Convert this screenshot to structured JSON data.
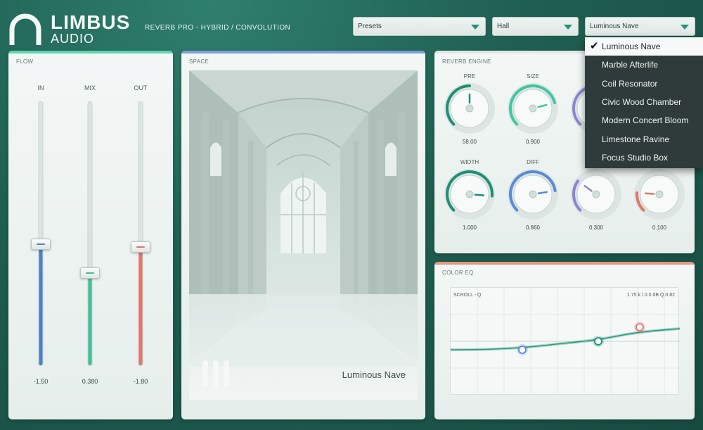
{
  "brand": {
    "name_top": "LIMBUS",
    "name_bottom": "AUDIO",
    "subtitle": "REVERB PRO  -  HYBRID / CONVOLUTION"
  },
  "dropdowns": {
    "presets": "Presets",
    "category": "Hall",
    "space": "Luminous Nave"
  },
  "panels": {
    "flow": "FLOW",
    "space": "SPACE",
    "engine": "REVERB ENGINE",
    "eq": "COLOR EQ"
  },
  "faders": [
    {
      "label": "IN",
      "value": "-1.50",
      "level": 0.46,
      "color": "#4f7fc4"
    },
    {
      "label": "MIX",
      "value": "0.380",
      "level": 0.35,
      "color": "#3fbf9a"
    },
    {
      "label": "OUT",
      "value": "-1.80",
      "level": 0.45,
      "color": "#e0766a"
    }
  ],
  "space": {
    "name": "Luminous Nave"
  },
  "knobs": [
    {
      "label": "PRE",
      "value": "58.00",
      "level": 0.5,
      "color": "#1f8f76"
    },
    {
      "label": "SIZE",
      "value": "0.900",
      "level": 0.78,
      "color": "#3fc7a3"
    },
    {
      "label": "",
      "value": "",
      "level": 0.7,
      "color": "#8a84d6"
    },
    {
      "label": "",
      "value": "",
      "level": 0.5,
      "color": "#1f8f76"
    },
    {
      "label": "WIDTH",
      "value": "1.000",
      "level": 0.85,
      "color": "#1f8f76"
    },
    {
      "label": "DIFF",
      "value": "0.860",
      "level": 0.8,
      "color": "#5a8bd6"
    },
    {
      "label": "",
      "value": "0.300",
      "level": 0.3,
      "color": "#8a84d6"
    },
    {
      "label": "",
      "value": "0.100",
      "level": 0.18,
      "color": "#e0766a"
    }
  ],
  "eq": {
    "left_label": "SCROLL - Q",
    "right_label": "1.75 k / 0.0 dB   Q 0.82",
    "nodes": [
      {
        "band": "low",
        "color": "#5a8bd6"
      },
      {
        "band": "mid",
        "color": "#1f8f76"
      },
      {
        "band": "high",
        "color": "#e0766a"
      }
    ]
  },
  "menu": {
    "items": [
      "Luminous Nave",
      "Marble Afterlife",
      "Coil Resonator",
      "Civic Wood Chamber",
      "Modern Concert Bloom",
      "Limestone Ravine",
      "Focus Studio Box"
    ],
    "selected": 0
  }
}
